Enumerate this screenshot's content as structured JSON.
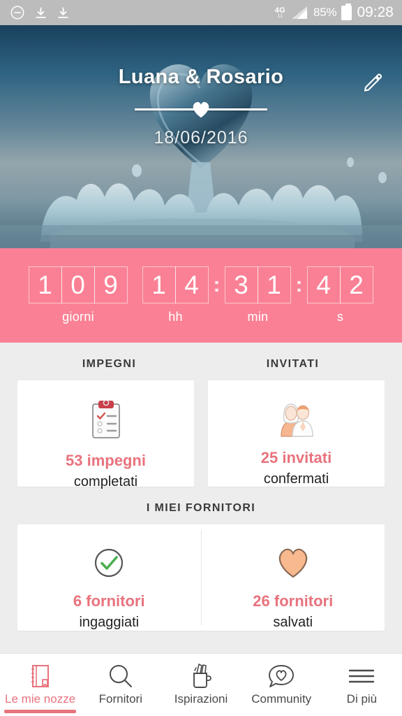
{
  "status_bar": {
    "left_icons": [
      "minus-circle-icon",
      "download-icon",
      "download-icon"
    ],
    "network": "4G",
    "network_sub": "11",
    "battery": "85%",
    "time": "09:28"
  },
  "hero": {
    "couple_names": "Luana & Rosario",
    "wedding_date": "18/06/2016",
    "edit_icon": "pencil-icon",
    "divider_icon": "heart-icon"
  },
  "countdown": {
    "groups": [
      {
        "id": "days",
        "digits": [
          "1",
          "0",
          "9"
        ],
        "label": "giorni",
        "separator": ""
      },
      {
        "id": "hours",
        "digits": [
          "1",
          "4"
        ],
        "label": "hh",
        "separator": ":"
      },
      {
        "id": "minutes",
        "digits": [
          "3",
          "1"
        ],
        "label": "min",
        "separator": ":"
      },
      {
        "id": "seconds",
        "digits": [
          "4",
          "2"
        ],
        "label": "s",
        "separator": ""
      }
    ],
    "background_color": "#fa8195"
  },
  "sections": {
    "impegni_title": "IMPEGNI",
    "invitati_title": "INVITATI",
    "fornitori_title": "I MIEI FORNITORI"
  },
  "cards": {
    "impegni": {
      "icon": "clipboard-checklist-icon",
      "main": "53 impegni",
      "sub": "completati"
    },
    "invitati": {
      "icon": "couple-icon",
      "main": "25 invitati",
      "sub": "confermati"
    },
    "fornitori_ingaggiati": {
      "icon": "check-circle-icon",
      "main": "6 fornitori",
      "sub": "ingaggiati"
    },
    "fornitori_salvati": {
      "icon": "heart-filled-icon",
      "main": "26 fornitori",
      "sub": "salvati"
    }
  },
  "navbar": {
    "items": [
      {
        "label": "Le mie nozze",
        "icon": "book-icon",
        "active": true
      },
      {
        "label": "Fornitori",
        "icon": "search-icon",
        "active": false
      },
      {
        "label": "Ispirazioni",
        "icon": "pencil-cup-icon",
        "active": false
      },
      {
        "label": "Community",
        "icon": "speech-heart-icon",
        "active": false
      },
      {
        "label": "Di più",
        "icon": "hamburger-icon",
        "active": false
      }
    ]
  },
  "colors": {
    "accent_pink": "#e8737d",
    "countdown_pink": "#fa8195",
    "page_bg": "#ededed",
    "status_bar": "#bcbcbc",
    "peach": "#f7b68c",
    "green": "#4caf50"
  }
}
